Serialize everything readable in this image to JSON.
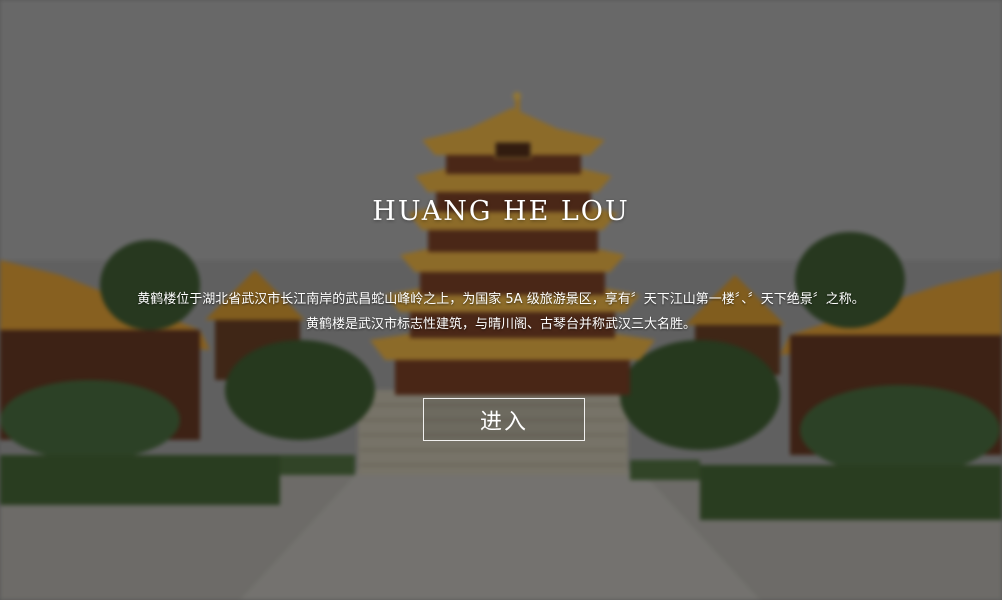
{
  "hero": {
    "title": "HUANG HE LOU",
    "intro_line1": "黄鹤楼位于湖北省武汉市长江南岸的武昌蛇山峰岭之上，为国家 5A 级旅游景区，享有〞天下江山第一楼〞、〞天下绝景〞之称。",
    "intro_line2": "黄鹤楼是武汉市标志性建筑，与晴川阁、古琴台并称武汉三大名胜。",
    "enter_label": "进入"
  },
  "background": {
    "subject": "pagoda-tower",
    "colors": {
      "sky": "#7d7d7d",
      "roof": "#b8892e",
      "wall": "#5a2a14",
      "foliage": "#2f4a22",
      "plaza": "#8d8b86"
    }
  }
}
